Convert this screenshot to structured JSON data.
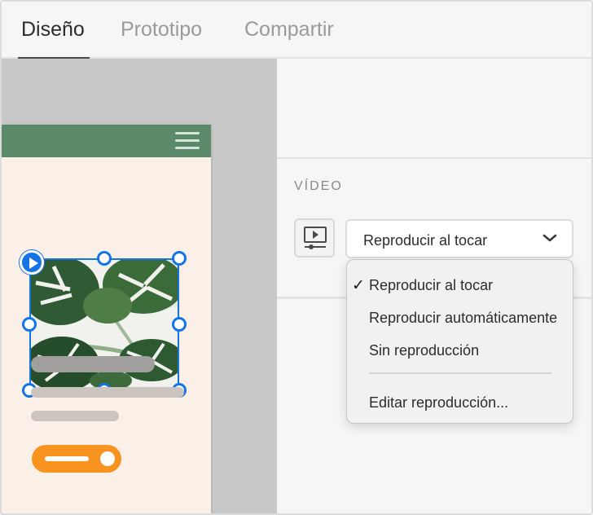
{
  "tabs": [
    {
      "label": "Diseño",
      "active": true
    },
    {
      "label": "Prototipo",
      "active": false
    },
    {
      "label": "Compartir",
      "active": false
    }
  ],
  "canvas": {
    "artboard": {
      "header_color": "#5b8a6a",
      "background_color": "#fbf0e8",
      "menu_icon": "hamburger-icon",
      "video_badge_icon": "play-icon",
      "cta_color": "#f7931e"
    },
    "background_color": "#c8c8c8"
  },
  "panel": {
    "section_title": "VÍDEO",
    "video_icon": "video-playback-icon",
    "playback_dropdown": {
      "selected": "Reproducir al tocar",
      "icon": "chevron-down-icon"
    }
  },
  "playback_menu": {
    "items": [
      {
        "label": "Reproducir al tocar",
        "checked": true
      },
      {
        "label": "Reproducir automáticamente",
        "checked": false
      },
      {
        "label": "Sin reproducción",
        "checked": false
      },
      {
        "label": "Editar reproducción...",
        "checked": false
      }
    ],
    "check_glyph": "✓"
  },
  "colors": {
    "selection": "#1473e6",
    "accent_orange": "#f7931e"
  }
}
